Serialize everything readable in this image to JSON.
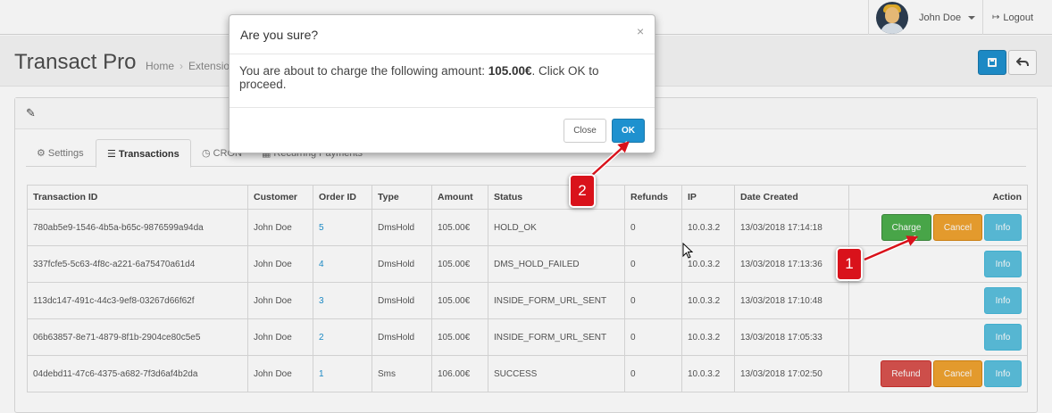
{
  "header": {
    "user_name": "John Doe",
    "logout_label": "Logout"
  },
  "page": {
    "title": "Transact Pro",
    "breadcrumb": [
      "Home",
      "Extension"
    ]
  },
  "tabs": [
    {
      "label": "Settings",
      "icon": "gear-icon"
    },
    {
      "label": "Transactions",
      "icon": "list-icon"
    },
    {
      "label": "CRON",
      "icon": "clock-icon"
    },
    {
      "label": "Recurring Payments",
      "icon": "calendar-icon"
    }
  ],
  "table": {
    "columns": [
      "Transaction ID",
      "Customer",
      "Order ID",
      "Type",
      "Amount",
      "Status",
      "Refunds",
      "IP",
      "Date Created",
      "Action"
    ],
    "rows": [
      {
        "id": "780ab5e9-1546-4b5a-b65c-9876599a94da",
        "customer": "John Doe",
        "order": "5",
        "type": "DmsHold",
        "amount": "105.00€",
        "status": "HOLD_OK",
        "refunds": "0",
        "ip": "10.0.3.2",
        "date": "13/03/2018 17:14:18",
        "actions": [
          "Charge",
          "Cancel",
          "Info"
        ]
      },
      {
        "id": "337fcfe5-5c63-4f8c-a221-6a75470a61d4",
        "customer": "John Doe",
        "order": "4",
        "type": "DmsHold",
        "amount": "105.00€",
        "status": "DMS_HOLD_FAILED",
        "refunds": "0",
        "ip": "10.0.3.2",
        "date": "13/03/2018 17:13:36",
        "actions": [
          "Info"
        ]
      },
      {
        "id": "113dc147-491c-44c3-9ef8-03267d66f62f",
        "customer": "John Doe",
        "order": "3",
        "type": "DmsHold",
        "amount": "105.00€",
        "status": "INSIDE_FORM_URL_SENT",
        "refunds": "0",
        "ip": "10.0.3.2",
        "date": "13/03/2018 17:10:48",
        "actions": [
          "Info"
        ]
      },
      {
        "id": "06b63857-8e71-4879-8f1b-2904ce80c5e5",
        "customer": "John Doe",
        "order": "2",
        "type": "DmsHold",
        "amount": "105.00€",
        "status": "INSIDE_FORM_URL_SENT",
        "refunds": "0",
        "ip": "10.0.3.2",
        "date": "13/03/2018 17:05:33",
        "actions": [
          "Info"
        ]
      },
      {
        "id": "04debd11-47c6-4375-a682-7f3d6af4b2da",
        "customer": "John Doe",
        "order": "1",
        "type": "Sms",
        "amount": "106.00€",
        "status": "SUCCESS",
        "refunds": "0",
        "ip": "10.0.3.2",
        "date": "13/03/2018 17:02:50",
        "actions": [
          "Refund",
          "Cancel",
          "Info"
        ]
      }
    ]
  },
  "modal": {
    "title": "Are you sure?",
    "close_symbol": "×",
    "body_prefix": "You are about to charge the following amount: ",
    "amount": "105.00€",
    "body_suffix": ". Click OK to proceed.",
    "close_label": "Close",
    "ok_label": "OK"
  },
  "annotations": [
    "1",
    "2"
  ],
  "colors": {
    "primary": "#1e91cf",
    "success": "#4cae4c",
    "warning": "#f0a330",
    "info": "#5bc0de",
    "danger": "#d9534f",
    "annotation": "#d9121b"
  }
}
